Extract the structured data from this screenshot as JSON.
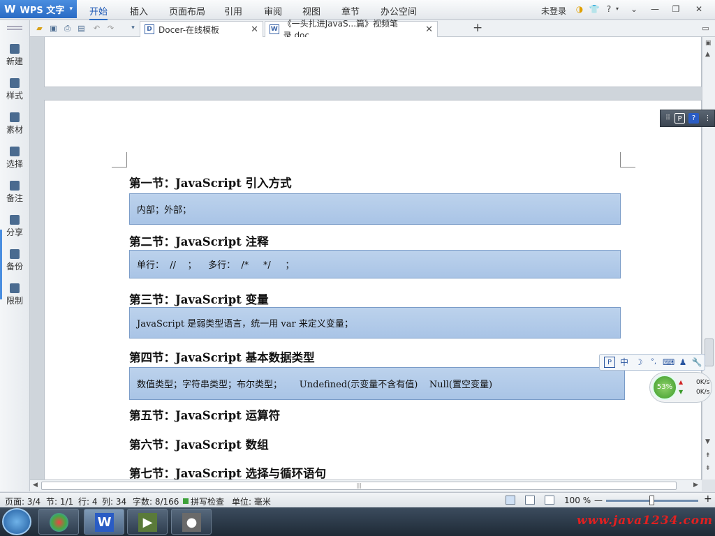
{
  "app": {
    "name": "WPS 文字",
    "menu_caret": "▾",
    "login": "未登录"
  },
  "menu": {
    "items": [
      "开始",
      "插入",
      "页面布局",
      "引用",
      "审阅",
      "视图",
      "章节",
      "办公空间"
    ]
  },
  "window_controls": {
    "help": "?",
    "minimize": "—",
    "restore": "❐",
    "close": "✕"
  },
  "tabs": [
    {
      "title": "Docer-在线模板",
      "icon": "D",
      "close": "✕"
    },
    {
      "title": "《一头扎进JavaS...篇》视频笔录.doc",
      "icon": "W",
      "close": "✕"
    }
  ],
  "tab_add": "+",
  "left_rail": [
    {
      "label": "新建",
      "icon": "new-doc-icon"
    },
    {
      "label": "样式",
      "icon": "style-icon"
    },
    {
      "label": "素材",
      "icon": "material-icon"
    },
    {
      "label": "选择",
      "icon": "select-icon"
    },
    {
      "label": "备注",
      "icon": "note-icon"
    },
    {
      "label": "分享",
      "icon": "share-icon"
    },
    {
      "label": "备份",
      "icon": "backup-icon"
    },
    {
      "label": "限制",
      "icon": "restrict-icon"
    }
  ],
  "document": {
    "sections": [
      {
        "heading": "第一节：JavaScript 引入方式",
        "box": "内部；外部；"
      },
      {
        "heading": "第二节：JavaScript 注释",
        "box": "单行：  //    ；    多行：  /*     */     ；"
      },
      {
        "heading": "第三节：JavaScript 变量",
        "box": "JavaScript 是弱类型语言，统一用 var 来定义变量；"
      },
      {
        "heading": "第四节：JavaScript 基本数据类型",
        "box": "数值类型；字符串类型；布尔类型；      Undefined(示变量不含有值)    Null(置空变量)"
      },
      {
        "heading": "第五节：JavaScript 运算符",
        "box": null
      },
      {
        "heading": "第六节：JavaScript 数组",
        "box": null
      },
      {
        "heading": "第七节：JavaScript 选择与循环语句",
        "box": null
      }
    ]
  },
  "ime_bar": {
    "items": [
      "中",
      "☽",
      "°,",
      "⌨",
      "♟",
      "🔧"
    ],
    "logo": "P"
  },
  "network": {
    "percent": "53%",
    "up": "0K/s",
    "down": "0K/s"
  },
  "status": {
    "page": "页面: 3/4",
    "section": "节: 1/1",
    "row": "行: 4",
    "col": "列: 34",
    "words": "字数: 8/166",
    "spell": "拼写检查",
    "unit": "单位: 毫米",
    "zoom": "100 %",
    "zoom_level_percent": 100,
    "zoom_minus": "—",
    "zoom_plus": "+"
  },
  "taskbar": {
    "watermark": "www.java1234.com"
  },
  "colors": {
    "accent": "#2a6bc4",
    "textbox_fill": "#b3cbea",
    "spell_ok": "#3da13a",
    "watermark": "#e02020"
  }
}
